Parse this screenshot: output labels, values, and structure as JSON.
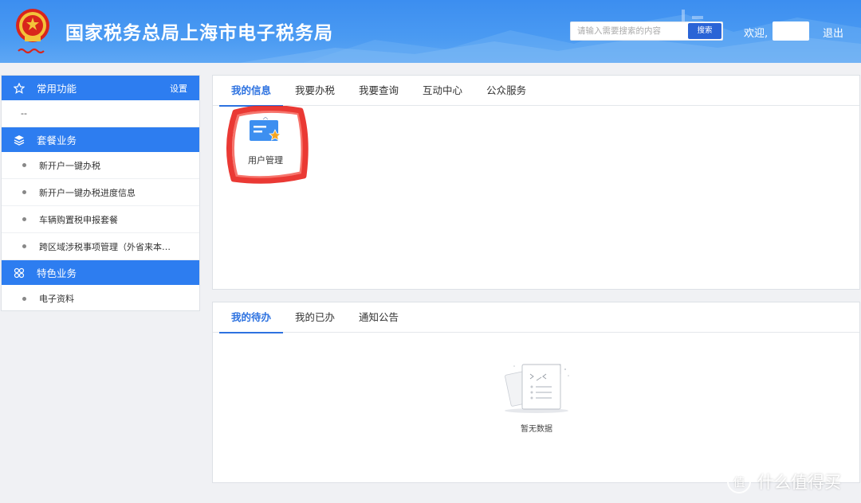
{
  "header": {
    "title": "国家税务总局上海市电子税务局",
    "search_placeholder": "请输入需要搜索的内容",
    "search_button": "搜索",
    "welcome": "欢迎,",
    "logout": "退出"
  },
  "sidebar": {
    "sections": [
      {
        "title": "常用功能",
        "icon": "star-icon",
        "action": "设置",
        "items": [],
        "empty_text": "--"
      },
      {
        "title": "套餐业务",
        "icon": "layers-icon",
        "items": [
          "新开户一键办税",
          "新开户一键办税进度信息",
          "车辆购置税申报套餐",
          "跨区域涉税事项管理（外省来本…"
        ]
      },
      {
        "title": "特色业务",
        "icon": "grid-icon",
        "items": [
          "电子资料"
        ]
      }
    ]
  },
  "panel_top": {
    "tabs": [
      "我的信息",
      "我要办税",
      "我要查询",
      "互动中心",
      "公众服务"
    ],
    "active_tab": 0,
    "apps": [
      {
        "label": "用户管理",
        "icon": "user-management-icon"
      }
    ]
  },
  "panel_bottom": {
    "tabs": [
      "我的待办",
      "我的已办",
      "通知公告"
    ],
    "active_tab": 0,
    "empty_text": "暂无数据"
  },
  "watermark": {
    "icon_char": "值",
    "text": "什么值得买"
  },
  "colors": {
    "primary": "#2d7df0",
    "header": "#4a9af2",
    "active_tab": "#2d72e0",
    "highlight": "#e8231e"
  }
}
